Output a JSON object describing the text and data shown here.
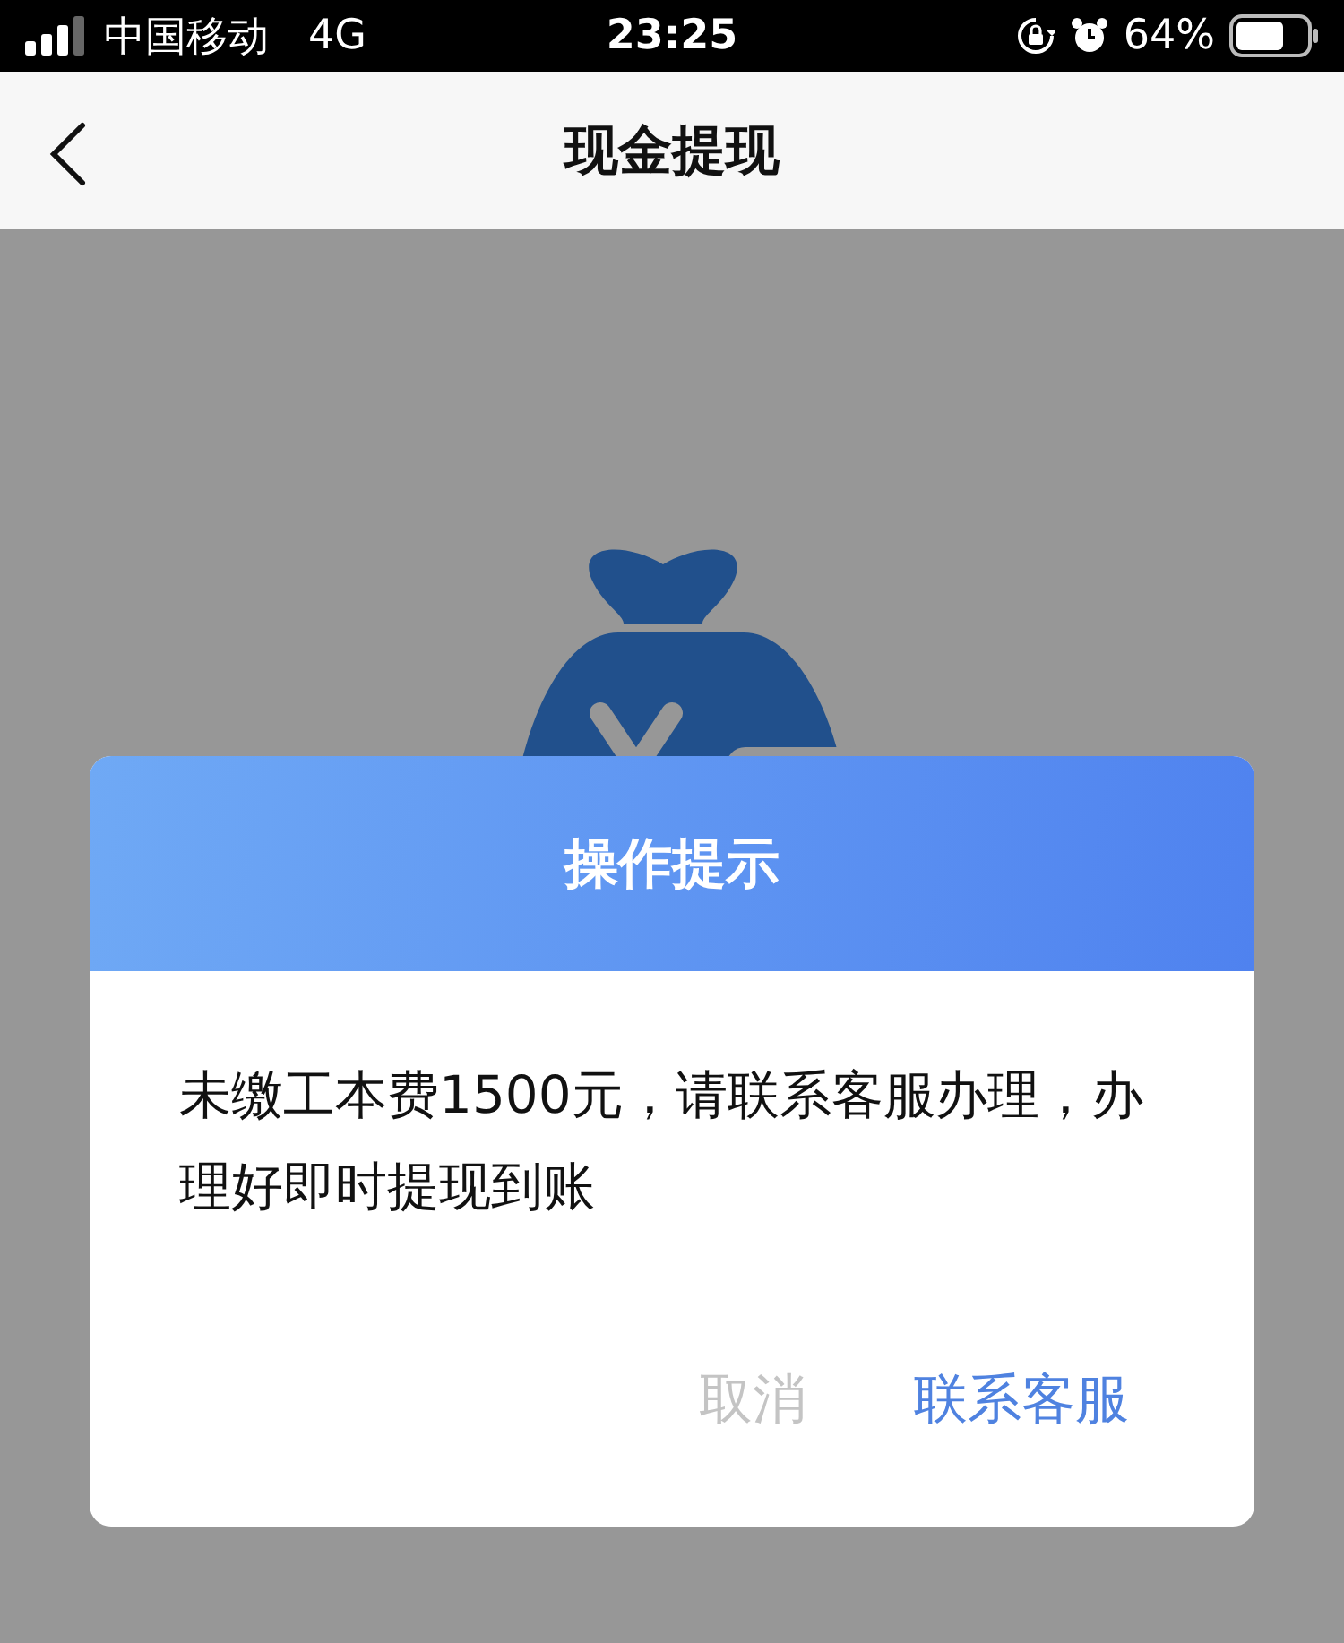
{
  "status_bar": {
    "carrier": "中国移动",
    "network": "4G",
    "time": "23:25",
    "battery": "64%"
  },
  "nav_bar": {
    "title": "现金提现"
  },
  "dialog": {
    "title": "操作提示",
    "message": "未缴工本费1500元，请联系客服办理，办理好即时提现到账",
    "buttons": [
      {
        "label": "取消",
        "kind": "cancel"
      },
      {
        "label": "联系客服",
        "kind": "primary"
      }
    ]
  }
}
